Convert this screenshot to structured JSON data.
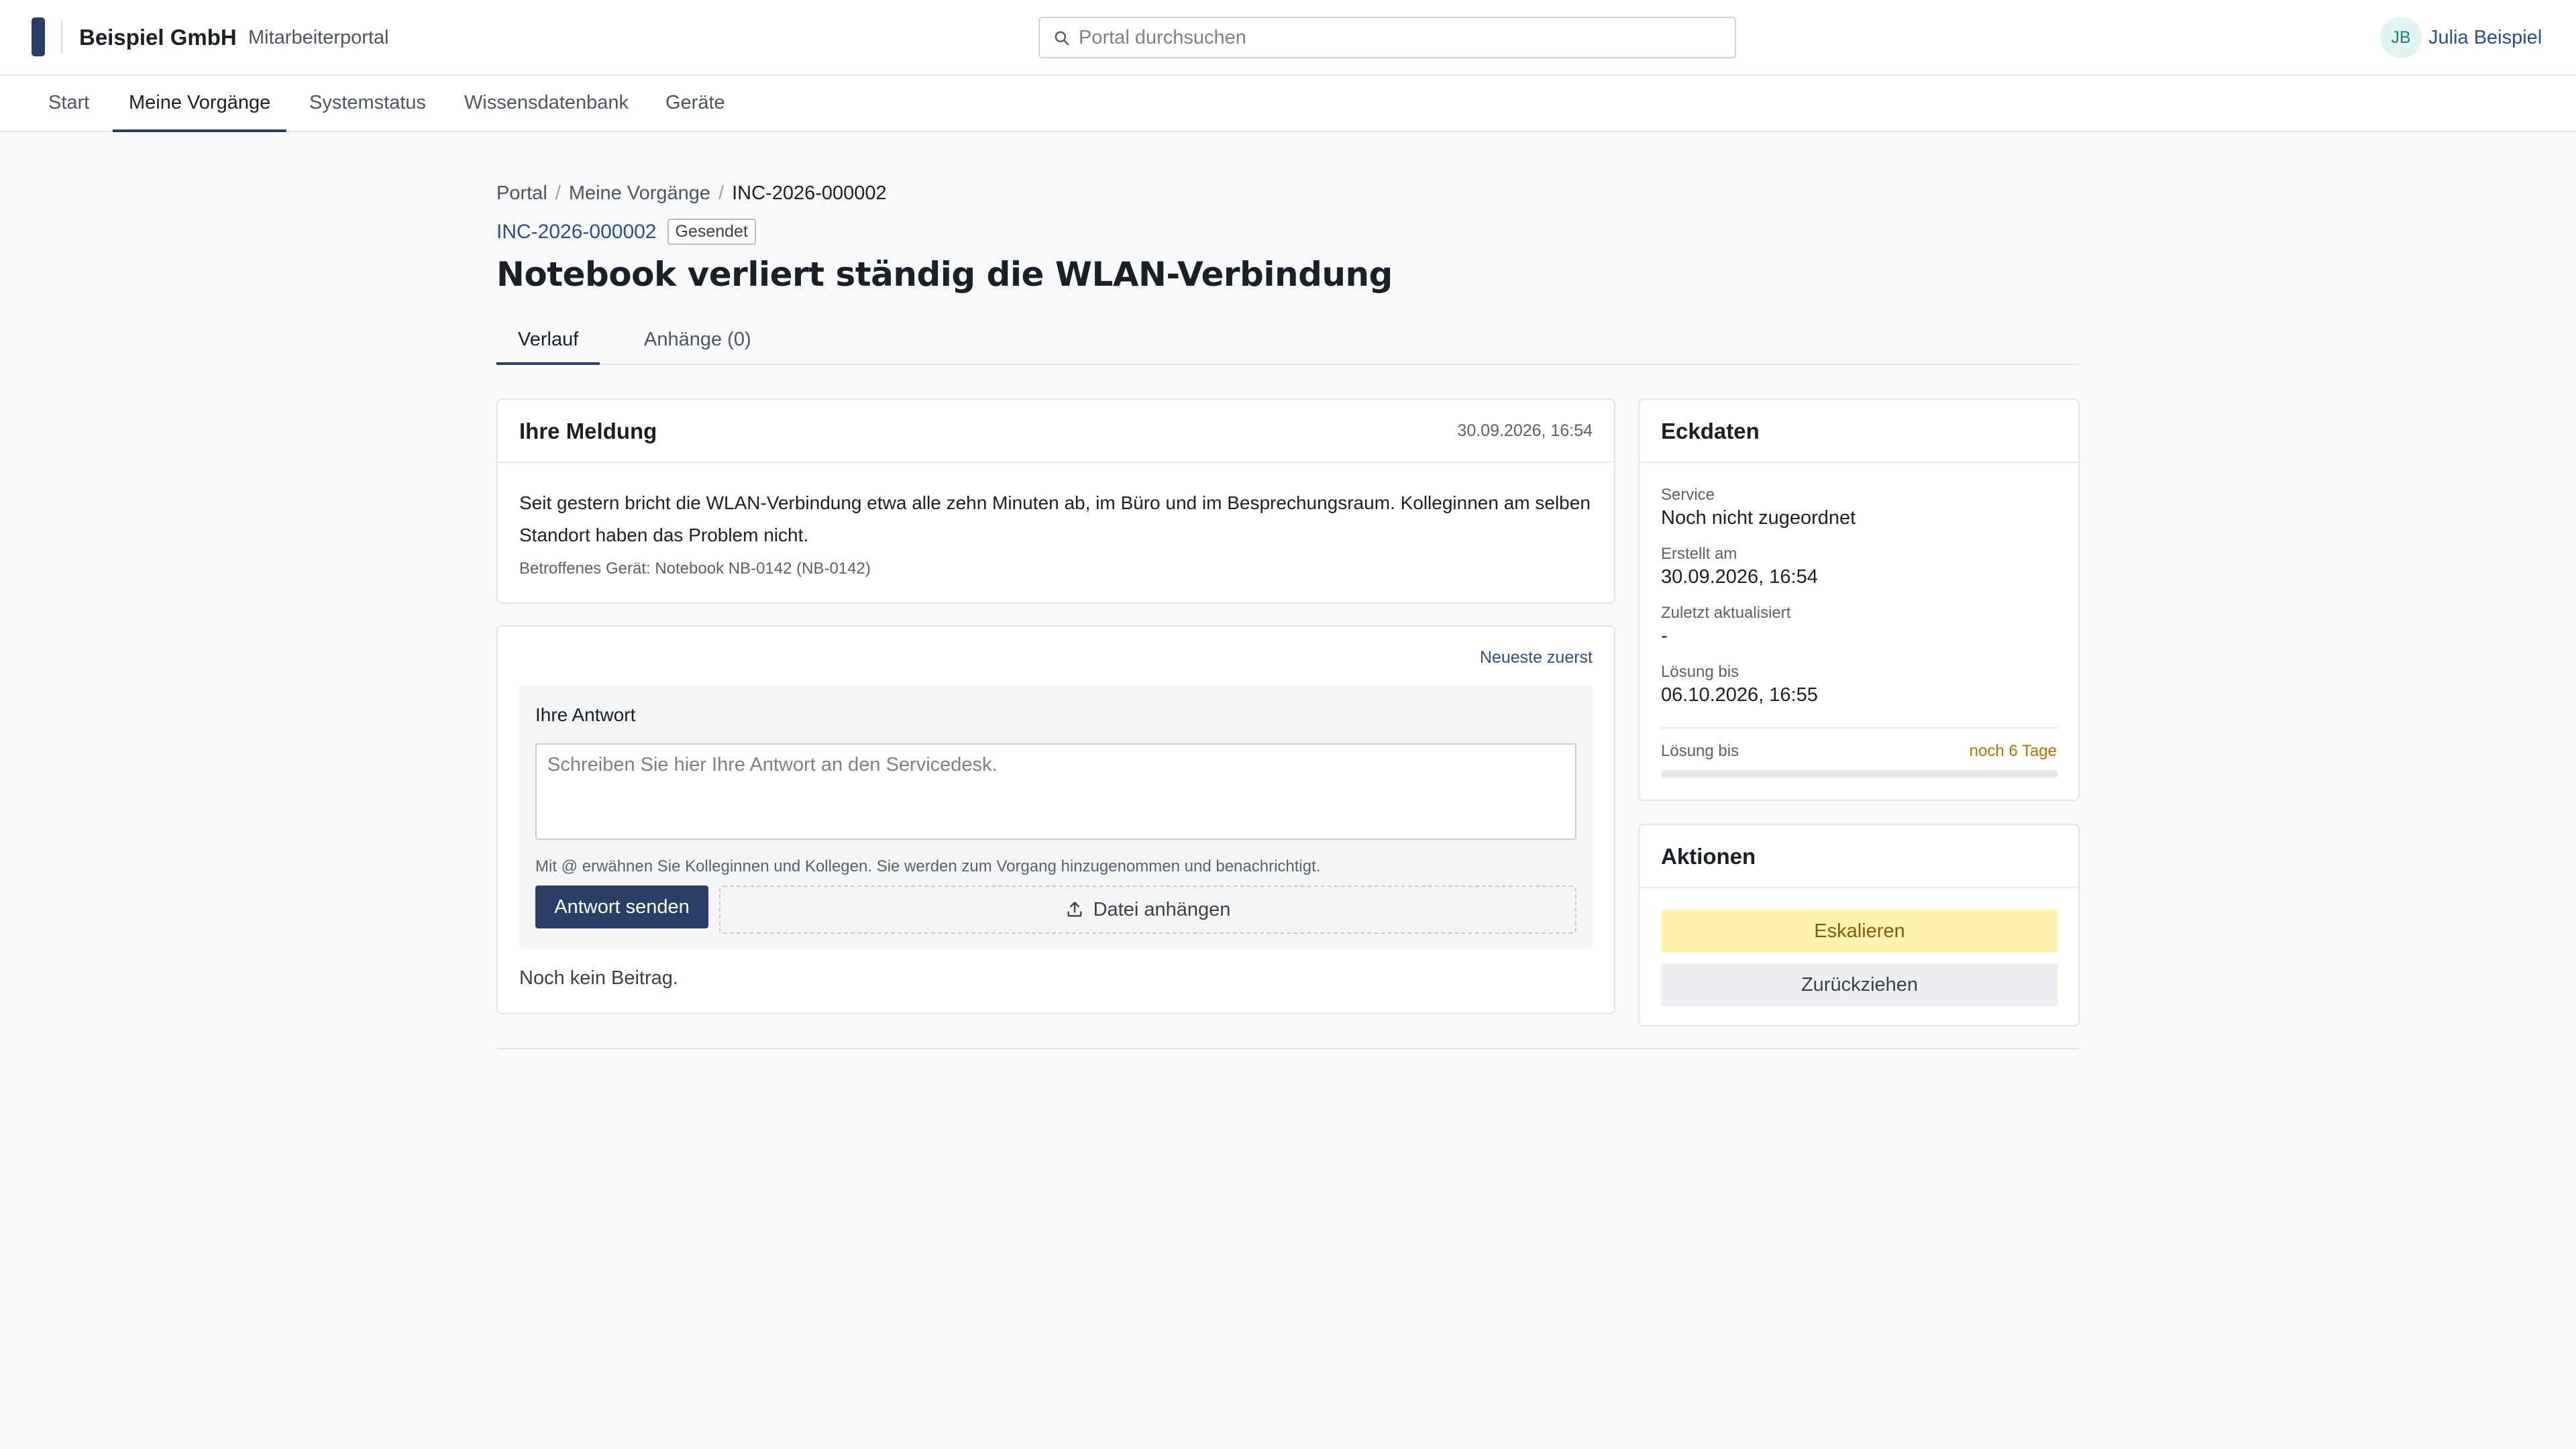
{
  "header": {
    "company": "Beispiel GmbH",
    "portal_name": "Mitarbeiterportal",
    "search_placeholder": "Portal durchsuchen",
    "user_initials": "JB",
    "user_name": "Julia Beispiel"
  },
  "nav": {
    "items": [
      "Start",
      "Meine Vorgänge",
      "Systemstatus",
      "Wissensdatenbank",
      "Geräte"
    ],
    "active": "Meine Vorgänge"
  },
  "breadcrumb": {
    "items": [
      "Portal",
      "Meine Vorgänge",
      "INC-2026-000002"
    ],
    "separator": "/"
  },
  "ticket": {
    "id": "INC-2026-000002",
    "status": "Gesendet",
    "title": "Notebook verliert ständig die WLAN-Verbindung"
  },
  "tabs": {
    "items": [
      "Verlauf",
      "Anhänge (0)"
    ],
    "active": "Verlauf"
  },
  "message": {
    "title": "Ihre Meldung",
    "date": "30.09.2026, 16:54",
    "text": "Seit gestern bricht die WLAN-Verbindung etwa alle zehn Minuten ab, im Büro und im Besprechungsraum. Kolleginnen am selben Standort haben das Problem nicht.",
    "device": "Betroffenes Gerät: Notebook NB-0142 (NB-0142)"
  },
  "reply": {
    "sort_label": "Neueste zuerst",
    "label": "Ihre Antwort",
    "placeholder": "Schreiben Sie hier Ihre Antwort an den Servicedesk.",
    "value": "",
    "hint": "Mit @ erwähnen Sie Kolleginnen und Kollegen. Sie werden zum Vorgang hinzugenommen und benachrichtigt.",
    "send_label": "Antwort senden",
    "attach_label": "Datei anhängen",
    "attach_icon": "upload-icon",
    "empty_note": "Noch kein Beitrag."
  },
  "facts": {
    "title": "Eckdaten",
    "service_label": "Service",
    "service_value": "Noch nicht zugeordnet",
    "created_label": "Erstellt am",
    "created_value": "30.09.2026, 16:54",
    "updated_label": "Zuletzt aktualisiert",
    "updated_value": "-",
    "due_label": "Lösung bis",
    "due_value": "06.10.2026, 16:55",
    "sla_label": "Lösung bis",
    "sla_value": "noch 6 Tage",
    "sla_progress": 0.0,
    "sla_color": "#b27206"
  },
  "actions": {
    "title": "Aktionen",
    "escalate_label": "Eskalieren",
    "withdraw_label": "Zurückziehen"
  },
  "colors": {
    "accent": "#2b3f66",
    "link": "#2b4f86",
    "escalate_bg": "#fdf2b0",
    "escalate_text": "#8a5a00"
  }
}
